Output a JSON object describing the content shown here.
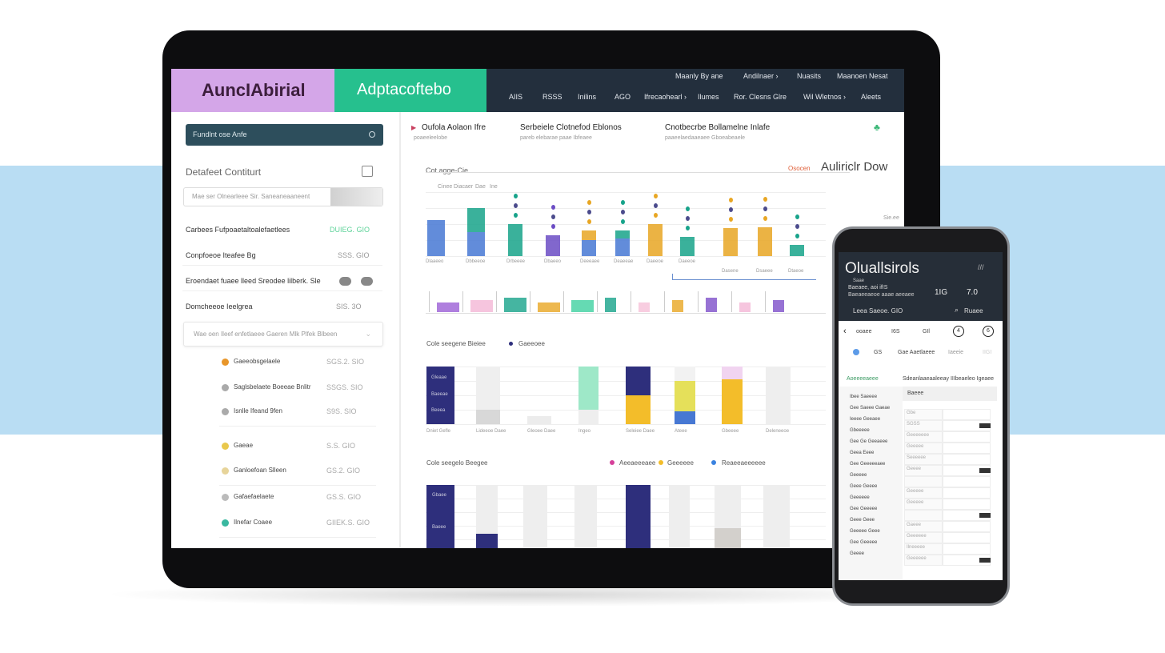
{
  "colors": {
    "band": "#b9ddf3",
    "purple": "#d4a6e8",
    "green": "#26c08e",
    "navy": "#232f3d",
    "search": "#2d4e5c",
    "indigo": "#2e2f7c",
    "yellow": "#f3bd2a",
    "blue": "#4778d3",
    "teal": "#17a38a",
    "orange": "#e8a623"
  },
  "header": {
    "logo": "AuncIAbirial",
    "brand": "Adptacoftebo",
    "top_links": [
      "Maanly By ane",
      "Andilnaer ›",
      "Nuasits",
      "Maanoen Nesat"
    ],
    "nav": [
      "AIIS",
      "RSSS",
      "Inilins",
      "AGO",
      "Ifrecaohearl ›",
      "Ilumes",
      "Ror. Clesns Glre",
      "Wil Wletnos ›",
      "Aleets"
    ]
  },
  "sidebar": {
    "search_value": "Fundlnt ose Anfe",
    "section_title": "Detafeet Contiturt",
    "filter_placeholder": "Mae ser Olnearleee Sir. Saneaneaaneent",
    "rows": [
      {
        "label": "Carbees Fufpoaetaltoalefaetlees",
        "value": "DUIEG. GIO"
      },
      {
        "label": "Conpfoeoe Iteafee Bg",
        "value": "SSS. GIO"
      },
      {
        "label": "Eroendaet fuaee lleed Sreodee lilberk. Sle",
        "value": ""
      },
      {
        "label": "Domcheeoe Ieelgrea",
        "value": "SIS. 3O"
      }
    ],
    "select_value": "Wae oen Ileef enfetlaeee Gaeren Mlk Plfek Blbeen",
    "items": [
      {
        "label": "Gaeeobsgelaele",
        "value": "SGS.2. SIO",
        "icon": "#e8962a"
      },
      {
        "label": "Saglsbelaete Boeeae Bnlitr",
        "value": "SSGS. SIO",
        "icon": "#aaa"
      },
      {
        "label": "Isnlle Ifeand 9fen",
        "value": "S9S. SIO",
        "icon": "#aaa"
      },
      {
        "label": "Gaeae",
        "value": "S.S. GIO",
        "icon": "#e9c84c"
      },
      {
        "label": "Ganloefoan Slleen",
        "value": "GS.2. GIO",
        "icon": "#e7d49a"
      },
      {
        "label": "Gafaefaelaete",
        "value": "GS.S. GIO",
        "icon": "#bbb"
      },
      {
        "label": "Ilnefar Coaee",
        "value": "GIIEK.S. GIO",
        "icon": "#39b8a0"
      }
    ]
  },
  "main": {
    "tabs": [
      {
        "label": "Oufola Aolaon Ifre",
        "sub": "poaeeleelobe"
      },
      {
        "label": "Serbeiele Clotnefod Eblonos",
        "sub": "pareb elebarae paae Ibfeaee"
      },
      {
        "label": "Cnotbecrbe Bollamelne Inlafe",
        "sub": "paaeelaedaaeaee Gboeabeaele"
      }
    ],
    "chart1": {
      "title": "Cot.agge-Cie",
      "badge": "Osocen",
      "heading": "Auliriclr Dow",
      "legend": [
        "Cinee",
        "Diacaer",
        "Dae",
        "Ine"
      ],
      "side": "Sie.ee",
      "values": [
        [
          45,
          0
        ],
        [
          30,
          30
        ],
        [
          40,
          0
        ],
        [
          26,
          0
        ],
        [
          20,
          12
        ],
        [
          22,
          10
        ],
        [
          0,
          40
        ],
        [
          0,
          24
        ],
        [
          0,
          35
        ],
        [
          0,
          36
        ],
        [
          0,
          14
        ]
      ],
      "labels": [
        "Dlaaeeo",
        "Dbbeeoe",
        "Drbeeee",
        "Dbaeeo",
        "Deeeaee",
        "Deaeeae",
        "Daeeoe",
        "Daeeoe",
        "Dasene",
        "Dsaeee",
        "Dtaeoe"
      ]
    },
    "chart2": {
      "title": "Cole seegene Bieiee",
      "legend": "Gaeeoee",
      "bar_labels": [
        "Gleaae",
        "Baeeae",
        "Beeea"
      ],
      "categories": [
        "Dniet Gefle",
        "Lideeoe Daee",
        "Gleoee Daee",
        "Ingeo",
        "Seleiee Daee",
        "Ateee",
        "Gbeeee",
        "Deleneeoe"
      ]
    },
    "chart3": {
      "title": "Cole seegelo Beegee",
      "legend": [
        "Aeeaeeeaee",
        "Geeeeee",
        "Reaeeaeeeeee"
      ],
      "bar_labels": [
        "Gbaee",
        "Baeee"
      ]
    }
  },
  "phone": {
    "title": "Oluallsirols",
    "sub": "Saae",
    "info1": "Baeaee, aoi ifIS",
    "info2": "Baeaeeaeoe aaae aeeaee",
    "stat1": "1IG",
    "stat2": "7.0",
    "filter": "Leea Saeoe. GIO",
    "search": "Ruaee",
    "tabs": [
      "ooaee",
      "I6S",
      "GIl",
      "4",
      "6"
    ],
    "chips": [
      "GS",
      "Gae Aaetlaeee",
      "Iaeeie",
      "IIGI"
    ],
    "status": "Aoeeeeaeee",
    "caption": "Sdeanlaaeaaleeay IIIbeaeleo Igeaee",
    "col_head": "Baeee",
    "rows": [
      [
        "Ibee Saeeee",
        ""
      ],
      [
        "Gee Saeee Gaeae",
        "Gbe"
      ],
      [
        "Ieeee Geeaee",
        "SGSS"
      ],
      [
        "Gbeeeee",
        "Geeeeeee"
      ],
      [
        "Gee Ge Geeaeee",
        "Geeeee"
      ],
      [
        "Geea Eeee",
        "Seeeeee"
      ],
      [
        "Gee Geeeeeaee",
        "Geeee"
      ],
      [
        "Geeeee",
        ""
      ],
      [
        "Geee Geeee",
        "Geeeee"
      ],
      [
        "Geeeeee",
        "Geeeee"
      ],
      [
        "Gee Geeeee",
        ""
      ],
      [
        "Geee Geee",
        "Gaeee"
      ],
      [
        "Geeeee Geee",
        "Geeeeee"
      ],
      [
        "Gee Geeeee",
        "Ilneeeee"
      ],
      [
        "Geeee",
        "Geeeeee"
      ]
    ]
  }
}
